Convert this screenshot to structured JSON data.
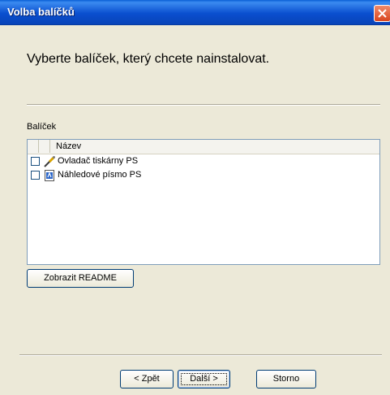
{
  "window": {
    "title": "Volba balíčků",
    "close_icon": "close-icon"
  },
  "heading": "Vyberte balíček, který chcete nainstalovat.",
  "section_label": "Balíček",
  "list": {
    "column_header": "Název",
    "items": [
      {
        "label": "Ovladač tiskárny PS",
        "icon": "printer-driver-icon",
        "checked": false
      },
      {
        "label": "Náhledové písmo PS",
        "icon": "font-preview-icon",
        "checked": false
      }
    ]
  },
  "buttons": {
    "readme": "Zobrazit README",
    "back": "< Zpět",
    "next": "Další >",
    "cancel": "Storno"
  },
  "colors": {
    "titlebar": "#0a4fcf",
    "window_bg": "#ece9d8",
    "close_button": "#d8461f"
  }
}
